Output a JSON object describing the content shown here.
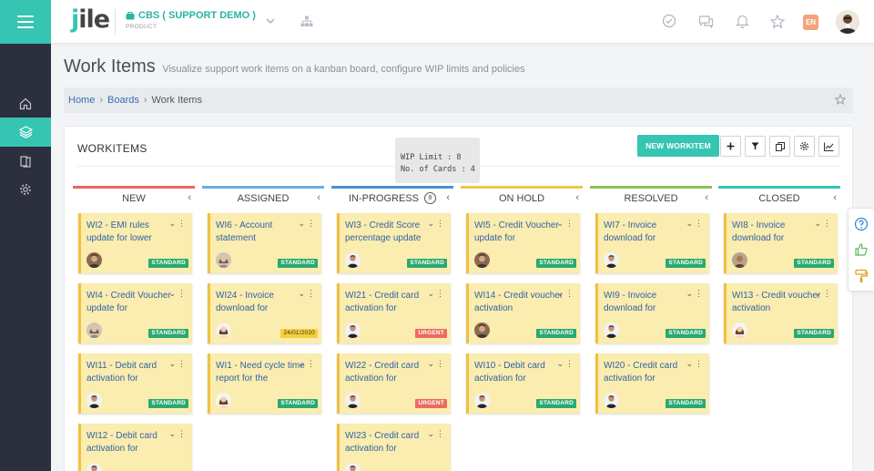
{
  "header": {
    "logo_text": "jile",
    "project_name": "CBS ( SUPPORT DEMO )",
    "project_type": "PRODUCT",
    "language": "EN",
    "icons": [
      "menu-icon",
      "briefcase-icon",
      "chevron-down-icon",
      "hierarchy-icon",
      "check-circle-icon",
      "chat-icon",
      "bell-icon",
      "star-icon"
    ]
  },
  "sidebar": {
    "items": [
      {
        "name": "home-icon"
      },
      {
        "name": "layers-icon",
        "active": true
      },
      {
        "name": "book-icon"
      },
      {
        "name": "gear-icon"
      }
    ]
  },
  "page": {
    "title": "Work Items",
    "subtitle": "Visualize support work items on a kanban board, configure WIP limits and policies"
  },
  "breadcrumb": [
    "Home",
    "Boards",
    "Work Items"
  ],
  "board": {
    "title": "WORKITEMS",
    "new_button": "NEW WORKITEM",
    "toolbar_icons": [
      "plus-icon",
      "filter-icon",
      "copy-icon",
      "settings-icon",
      "chart-icon"
    ],
    "tooltip": {
      "line1": "WIP Limit : 8",
      "line2": "No. of Cards : 4"
    },
    "columns": [
      {
        "name": "NEW",
        "color": "#e8675c",
        "cards": [
          {
            "title": "WI2 - EMI rules update for lower",
            "badge": "STANDARD",
            "avatar": "man"
          },
          {
            "title": "WI4 - Credit Voucher update for",
            "badge": "STANDARD",
            "avatar": "woman"
          },
          {
            "title": "WI11 - Debit card activation for",
            "badge": "STANDARD",
            "avatar": "man2"
          },
          {
            "title": "WI12 - Debit card activation for",
            "badge": "",
            "avatar": "man2"
          }
        ]
      },
      {
        "name": "ASSIGNED",
        "color": "#6aaee0",
        "cards": [
          {
            "title": "WI6 - Account statement",
            "badge": "STANDARD",
            "avatar": "woman"
          },
          {
            "title": "WI24 - Invoice download for",
            "badge": "24/01/2020",
            "avatar": "woman2"
          },
          {
            "title": "WI1 - Need cycle time report for the",
            "badge": "STANDARD",
            "avatar": "woman2"
          }
        ]
      },
      {
        "name": "IN-PROGRESS",
        "color": "#4a8fd6",
        "wip": "8",
        "cards": [
          {
            "title": "WI3 - Credit Score percentage update",
            "badge": "STANDARD",
            "avatar": "man2"
          },
          {
            "title": "WI21 - Credit card activation for",
            "badge": "URGENT",
            "avatar": "man2"
          },
          {
            "title": "WI22 - Credit card activation for",
            "badge": "URGENT",
            "avatar": "man2"
          },
          {
            "title": "WI23 - Credit card activation for",
            "badge": "",
            "avatar": "man2"
          }
        ]
      },
      {
        "name": "ON HOLD",
        "color": "#f3c443",
        "cards": [
          {
            "title": "WI5 - Credit Voucher update for",
            "badge": "STANDARD",
            "avatar": "man"
          },
          {
            "title": "WI14 - Credit voucher activation",
            "badge": "STANDARD",
            "avatar": "man"
          },
          {
            "title": "WI10 - Debit card activation for",
            "badge": "STANDARD",
            "avatar": "man2"
          }
        ]
      },
      {
        "name": "RESOLVED",
        "color": "#8cc05a",
        "cards": [
          {
            "title": "WI7 - Invoice download for",
            "badge": "STANDARD",
            "avatar": "man2"
          },
          {
            "title": "WI9 - Invoice download for",
            "badge": "STANDARD",
            "avatar": "man2"
          },
          {
            "title": "WI20 - Credit card activation for",
            "badge": "STANDARD",
            "avatar": "man2"
          }
        ]
      },
      {
        "name": "CLOSED",
        "color": "#36c5b2",
        "cards": [
          {
            "title": "WI8 - Invoice download for",
            "badge": "STANDARD",
            "avatar": "man3"
          },
          {
            "title": "WI13 - Credit voucher activation",
            "badge": "STANDARD",
            "avatar": "woman2"
          }
        ]
      }
    ]
  },
  "side_panel": [
    "help-icon",
    "thumbs-up-icon",
    "paint-roller-icon"
  ]
}
